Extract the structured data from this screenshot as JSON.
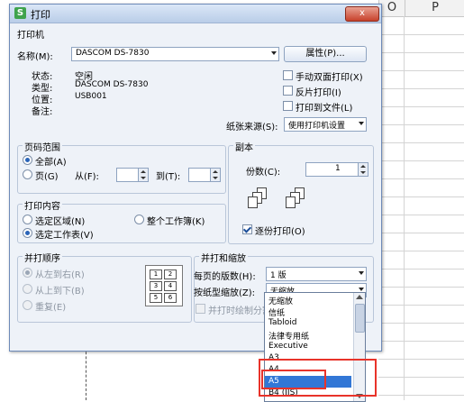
{
  "sheet": {
    "col_o": "O",
    "col_p": "P"
  },
  "dialog": {
    "title": "打印",
    "app_icon": "S",
    "close_label": "x",
    "printer": {
      "group_label": "打印机",
      "name_label": "名称(M):",
      "name_value": "DASCOM DS-7830",
      "properties_button": "属性(P)...",
      "status_label": "状态:",
      "status_value": "空闲",
      "type_label": "类型:",
      "type_value": "DASCOM DS-7830",
      "location_label": "位置:",
      "location_value": "USB001",
      "comment_label": "备注:",
      "manual_duplex": "手动双面打印(X)",
      "reverse_print": "反片打印(I)",
      "print_to_file": "打印到文件(L)",
      "paper_source_label": "纸张来源(S):",
      "paper_source_value": "使用打印机设置"
    },
    "page_range": {
      "group_label": "页码范围",
      "all": "全部(A)",
      "pages": "页(G)",
      "from": "从(F):",
      "to": "到(T):"
    },
    "copies": {
      "group_label": "副本",
      "count_label": "份数(C):",
      "count_value": "1",
      "collate": "逐份打印(O)"
    },
    "print_what": {
      "group_label": "打印内容",
      "selection": "选定区域(N)",
      "entire_workbook": "整个工作簿(K)",
      "active_sheet": "选定工作表(V)"
    },
    "order": {
      "group_label": "并打顺序",
      "left_to_right": "从左到右(R)",
      "top_to_bottom": "从上到下(B)",
      "repeat": "重复(E)",
      "grid": [
        "1",
        "2",
        "3",
        "4",
        "5",
        "6"
      ]
    },
    "zoom": {
      "group_label": "并打和缩放",
      "pages_per_sheet_label": "每页的版数(H):",
      "pages_per_sheet_value": "1 版",
      "scale_label": "按纸型缩放(Z):",
      "scale_value": "无缩放",
      "draw_borders": "并打时绘制分割"
    },
    "dropdown_items": [
      "无缩放",
      "信纸",
      "Tabloid",
      "法律专用纸",
      "Executive",
      "A3",
      "A4",
      "A5",
      "B4 (JIS)"
    ],
    "selected_item": "A5"
  }
}
